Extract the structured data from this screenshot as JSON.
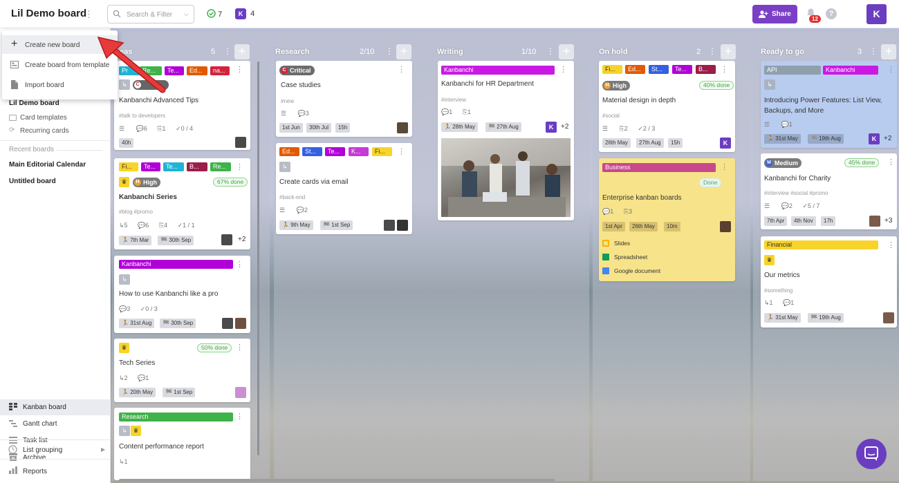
{
  "header": {
    "board_title": "Lil Demo board",
    "search_placeholder": "Search & Filter",
    "done_count": "7",
    "kanbanchi_letter": "K",
    "members_count": "4",
    "share_label": "Share",
    "notifications_count": "12",
    "help_glyph": "?",
    "user_initial": "K"
  },
  "menu": {
    "items": [
      {
        "label": "Create new board",
        "icon": "plus-icon"
      },
      {
        "label": "Create board from template",
        "icon": "template-icon"
      },
      {
        "label": "Import board",
        "icon": "file-icon"
      }
    ]
  },
  "sidebar": {
    "current_board": "Lil Demo board",
    "sub_items": [
      "Card templates",
      "Recurring cards"
    ],
    "recent_heading": "Recent boards",
    "recent": [
      "Main Editorial Calendar",
      "Untitled board"
    ],
    "views": [
      "Kanban board",
      "Gantt chart",
      "Task list",
      "Archive"
    ],
    "list_grouping": "List grouping",
    "reports": "Reports"
  },
  "columns": [
    {
      "title": "eas",
      "count": "5"
    },
    {
      "title": "Research",
      "count": "2/10"
    },
    {
      "title": "Writing",
      "count": "1/10"
    },
    {
      "title": "On hold",
      "count": "2"
    },
    {
      "title": "Ready to go",
      "count": "3"
    }
  ],
  "colors": {
    "accent": "#6a3ec1",
    "green": "#3fb24a",
    "purple": "#b100d8",
    "orange": "#e25a00",
    "red": "#d3243b",
    "cyan": "#1fb4d6",
    "blue": "#3560e0",
    "yellow": "#f8d42a",
    "maroon": "#9b1d4a",
    "business": "#c8488c"
  },
  "cards": {
    "c1": {
      "labels": [
        "Pr",
        "Re...",
        "Te...",
        "Ed...",
        "na..."
      ],
      "critical": "C",
      "title": "Kanbanchi Advanced Tips",
      "tag": "#talk to developers",
      "comments": "6",
      "attachments": "1",
      "checklist": "0 / 4",
      "chip": "40h"
    },
    "c2": {
      "labels": [
        "Fi...",
        "Te...",
        "Te...",
        "B...",
        "Re..."
      ],
      "priority": "High",
      "done": "67% done",
      "title": "Kanbanchi Series",
      "tag": "#blog #promo",
      "subcards": "5",
      "comments": "6",
      "attachments": "4",
      "checklist": "1 / 1",
      "start": "7th Mar",
      "due": "30th Sep",
      "more": "+2"
    },
    "c3": {
      "label": "Kanbanchi",
      "title": "How to use Kanbanchi like a pro",
      "comments": "3",
      "checklist": "0 / 3",
      "start": "31st Aug",
      "due": "30th Sep"
    },
    "c4": {
      "done": "50% done",
      "title": "Tech Series",
      "subcards": "2",
      "comments": "1",
      "start": "20th May",
      "due": "1st Sep"
    },
    "c5": {
      "label": "Research",
      "title": "Content performance report",
      "subcards": "1"
    },
    "r1": {
      "priority": "Critical",
      "title": "Case studies",
      "tag": "#new",
      "comments": "3",
      "chips": [
        "1st Jun",
        "30th Jul",
        "15h"
      ]
    },
    "r2": {
      "labels": [
        "Ed...",
        "St...",
        "Te...",
        "K...",
        "Fi..."
      ],
      "title": "Create cards via email",
      "tag": "#back-end",
      "comments": "2",
      "start": "9th May",
      "due": "1st Sep"
    },
    "w1": {
      "label": "Kanbanchi",
      "title": "Kanbanchi for HR Department",
      "tag": "#interview",
      "comments": "1",
      "attachments": "1",
      "start": "28th May",
      "due": "27th Aug",
      "more": "+2"
    },
    "o1": {
      "labels": [
        "Fi...",
        "Ed...",
        "St...",
        "Te...",
        "B..."
      ],
      "priority": "High",
      "done": "40% done",
      "title": "Material design in depth",
      "tag": "#social",
      "attachments": "2",
      "checklist": "2 / 3",
      "chips": [
        "26th May",
        "27th Aug",
        "15h"
      ]
    },
    "o2": {
      "label": "Business",
      "status": "Done",
      "title": "Enterprise kanban boards",
      "comments": "1",
      "attachments": "3",
      "chips": [
        "1st Apr",
        "26th May",
        "10m"
      ],
      "files": [
        "Slides",
        "Spreadsheet",
        "Google document"
      ]
    },
    "g1": {
      "labels": [
        "API",
        "Kanbanchi"
      ],
      "title": "Introducing Power Features: List View, Backups, and More",
      "comments": "1",
      "start": "31st May",
      "due": "19th Aug",
      "more": "+2"
    },
    "g2": {
      "priority": "Medium",
      "done": "45% done",
      "title": "Kanbanchi for Charity",
      "tag": "#interview #social #promo",
      "comments": "2",
      "checklist": "5 / 7",
      "chips": [
        "7th Apr",
        "4th Nov",
        "17h"
      ],
      "more": "+3"
    },
    "g3": {
      "label": "Financial",
      "title": "Our metrics",
      "tag": "#something",
      "subcards": "1",
      "comments": "1",
      "start": "31st May",
      "due": "19th Aug"
    }
  }
}
